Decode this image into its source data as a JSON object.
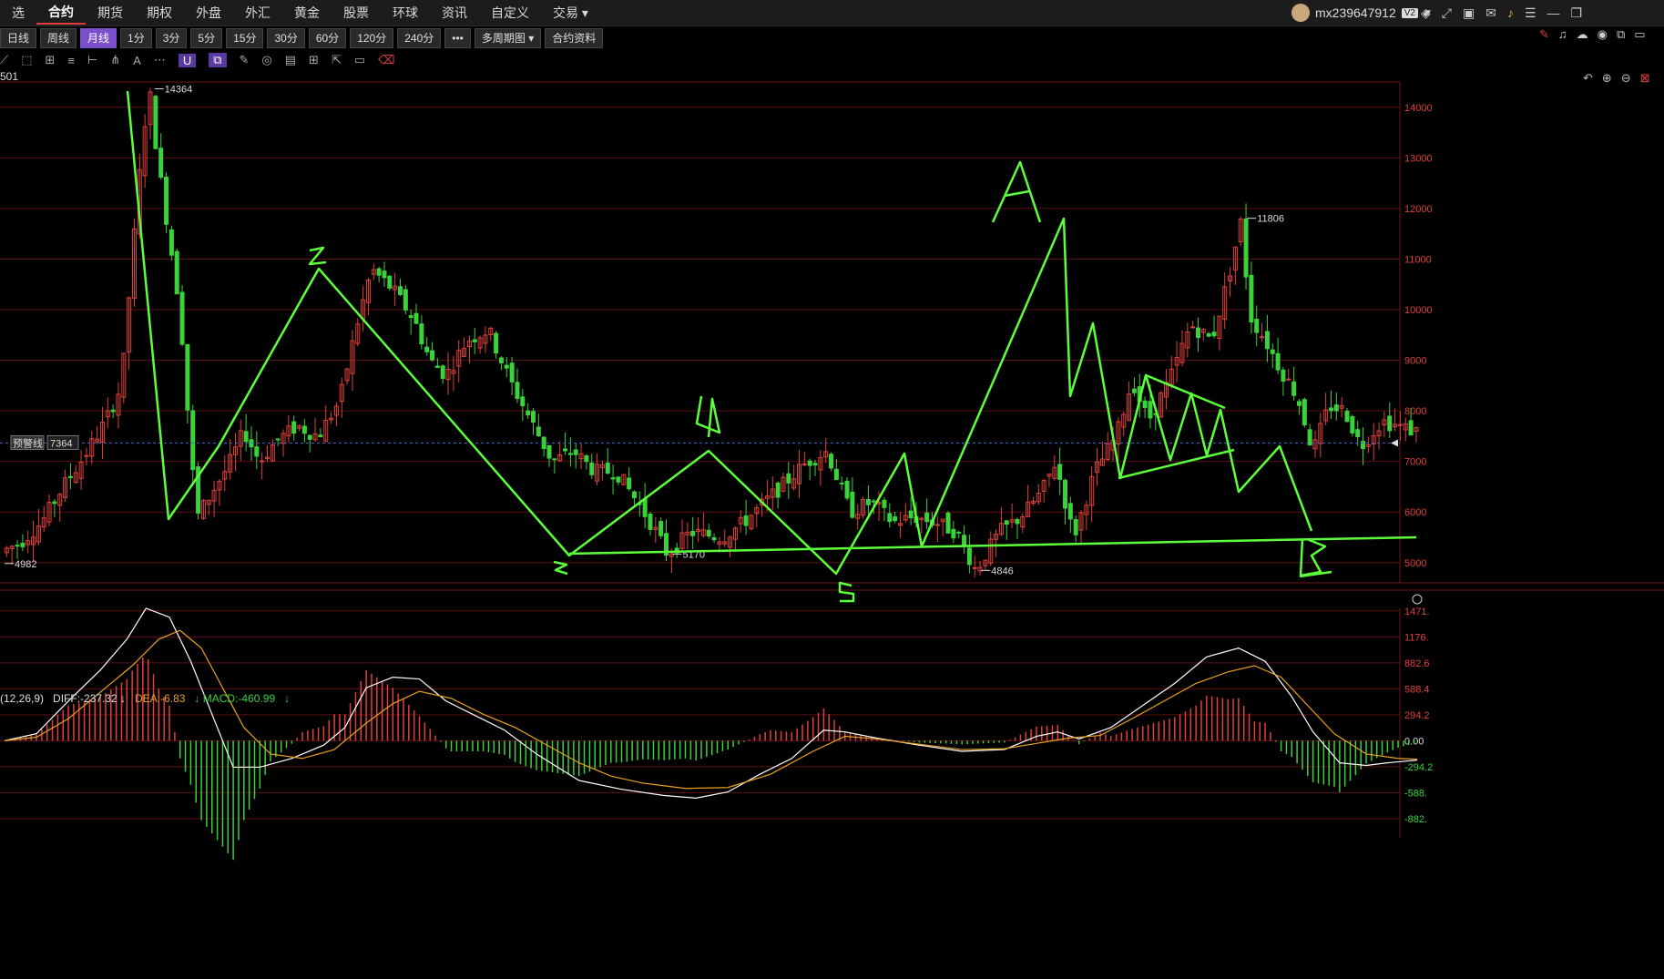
{
  "nav": {
    "items": [
      "选",
      "合约",
      "期货",
      "期权",
      "外盘",
      "外汇",
      "黄金",
      "股票",
      "环球",
      "资讯",
      "自定义",
      "交易 ▾"
    ],
    "active_index": 1
  },
  "user": {
    "name": "mx239647912",
    "badge": "V2"
  },
  "periods": {
    "items": [
      "日线",
      "周线",
      "月线",
      "1分",
      "3分",
      "5分",
      "15分",
      "30分",
      "60分",
      "120分",
      "240分",
      "•••",
      "多周期图 ▾",
      "合约资料"
    ],
    "active_index": 2
  },
  "code_label": "501",
  "alert": {
    "label": "预警线",
    "value": "7364"
  },
  "macd_label": {
    "params": "(12,26,9)",
    "diff": "DIFF:-237.32 ↓",
    "dea": "DEA:-6.83",
    "macd": "↓ MACD:-460.99",
    "arrow": "↓"
  },
  "colors": {
    "up": "#e0403a",
    "down": "#3ad13a",
    "drawing": "#5bff3a",
    "diff_line": "#ffffff",
    "dea_line": "#e8a020",
    "grid": "#5a1010"
  },
  "chart_data": [
    {
      "type": "candlestick",
      "title": "",
      "ylim": [
        4600,
        14500
      ],
      "y_ticks": [
        14000,
        13000,
        12000,
        11000,
        10000,
        9000,
        8000,
        7000,
        6000,
        5000
      ],
      "y_tick_labels": [
        "14000",
        "13000",
        "12000",
        "11000",
        "10000",
        "9000",
        "8000",
        "7000",
        "6000",
        "5000"
      ],
      "annotations": [
        {
          "label": "14364",
          "value": 14364
        },
        {
          "label": "11806",
          "value": 11806
        },
        {
          "label": "5170",
          "value": 5170
        },
        {
          "label": "4846",
          "value": 4846
        },
        {
          "label": "4982",
          "value": 4982
        }
      ],
      "current_price": 7364,
      "price_path": [
        [
          0,
          5200
        ],
        [
          20,
          5400
        ],
        [
          40,
          5800
        ],
        [
          60,
          6500
        ],
        [
          80,
          7100
        ],
        [
          100,
          7800
        ],
        [
          115,
          8500
        ],
        [
          125,
          11000
        ],
        [
          135,
          13400
        ],
        [
          141,
          14364
        ],
        [
          150,
          12800
        ],
        [
          160,
          11400
        ],
        [
          170,
          10000
        ],
        [
          180,
          7200
        ],
        [
          186,
          5900
        ],
        [
          200,
          6400
        ],
        [
          215,
          6900
        ],
        [
          230,
          7600
        ],
        [
          245,
          7000
        ],
        [
          260,
          7400
        ],
        [
          280,
          7700
        ],
        [
          300,
          7500
        ],
        [
          320,
          8200
        ],
        [
          335,
          9600
        ],
        [
          350,
          10800
        ],
        [
          370,
          10400
        ],
        [
          390,
          9800
        ],
        [
          405,
          9000
        ],
        [
          420,
          8700
        ],
        [
          440,
          9400
        ],
        [
          460,
          9600
        ],
        [
          480,
          8600
        ],
        [
          500,
          7800
        ],
        [
          520,
          7000
        ],
        [
          540,
          7200
        ],
        [
          560,
          6800
        ],
        [
          580,
          6800
        ],
        [
          600,
          6200
        ],
        [
          615,
          5700
        ],
        [
          628,
          5170
        ],
        [
          650,
          5600
        ],
        [
          680,
          5500
        ],
        [
          700,
          5800
        ],
        [
          720,
          6200
        ],
        [
          740,
          6600
        ],
        [
          760,
          7000
        ],
        [
          778,
          7200
        ],
        [
          800,
          6000
        ],
        [
          820,
          6200
        ],
        [
          840,
          5800
        ],
        [
          860,
          5900
        ],
        [
          880,
          5800
        ],
        [
          900,
          5600
        ],
        [
          918,
          4846
        ],
        [
          940,
          5600
        ],
        [
          960,
          5900
        ],
        [
          980,
          6400
        ],
        [
          993,
          7000
        ],
        [
          1010,
          5500
        ],
        [
          1030,
          6800
        ],
        [
          1050,
          7500
        ],
        [
          1065,
          8600
        ],
        [
          1080,
          7800
        ],
        [
          1100,
          8600
        ],
        [
          1120,
          9700
        ],
        [
          1140,
          9400
        ],
        [
          1155,
          10600
        ],
        [
          1168,
          11806
        ],
        [
          1175,
          9900
        ],
        [
          1190,
          9400
        ],
        [
          1205,
          8800
        ],
        [
          1220,
          8300
        ],
        [
          1235,
          7200
        ],
        [
          1250,
          8100
        ],
        [
          1265,
          8000
        ],
        [
          1280,
          7300
        ],
        [
          1300,
          7800
        ],
        [
          1315,
          7700
        ],
        [
          1330,
          7600
        ]
      ]
    },
    {
      "type": "macd",
      "params": "(12,26,9)",
      "y_ticks": [
        1471,
        1176,
        882.6,
        588.4,
        294.2,
        0,
        -294.2,
        -588.4,
        -882.6
      ],
      "y_tick_labels": [
        "1471.",
        "1176.",
        "882.6",
        "588.4",
        "294.2",
        "0.00",
        "-294.2",
        "-588.",
        "-882."
      ],
      "ylim": [
        -1100,
        1500
      ],
      "diff_path": [
        [
          0,
          0
        ],
        [
          30,
          80
        ],
        [
          60,
          450
        ],
        [
          90,
          800
        ],
        [
          115,
          1150
        ],
        [
          133,
          1500
        ],
        [
          155,
          1400
        ],
        [
          175,
          900
        ],
        [
          195,
          300
        ],
        [
          215,
          -300
        ],
        [
          240,
          -300
        ],
        [
          270,
          -200
        ],
        [
          300,
          -50
        ],
        [
          320,
          150
        ],
        [
          340,
          600
        ],
        [
          365,
          720
        ],
        [
          390,
          700
        ],
        [
          415,
          450
        ],
        [
          440,
          300
        ],
        [
          470,
          120
        ],
        [
          500,
          -150
        ],
        [
          540,
          -450
        ],
        [
          580,
          -550
        ],
        [
          620,
          -620
        ],
        [
          650,
          -650
        ],
        [
          680,
          -580
        ],
        [
          710,
          -380
        ],
        [
          740,
          -200
        ],
        [
          770,
          120
        ],
        [
          790,
          100
        ],
        [
          820,
          30
        ],
        [
          860,
          -50
        ],
        [
          900,
          -120
        ],
        [
          940,
          -100
        ],
        [
          970,
          50
        ],
        [
          990,
          100
        ],
        [
          1010,
          20
        ],
        [
          1040,
          150
        ],
        [
          1070,
          400
        ],
        [
          1100,
          650
        ],
        [
          1130,
          950
        ],
        [
          1160,
          1050
        ],
        [
          1185,
          900
        ],
        [
          1210,
          500
        ],
        [
          1230,
          100
        ],
        [
          1255,
          -250
        ],
        [
          1280,
          -280
        ],
        [
          1300,
          -250
        ],
        [
          1328,
          -220
        ]
      ],
      "dea_path": [
        [
          0,
          0
        ],
        [
          30,
          40
        ],
        [
          60,
          250
        ],
        [
          90,
          550
        ],
        [
          120,
          850
        ],
        [
          145,
          1150
        ],
        [
          165,
          1250
        ],
        [
          185,
          1050
        ],
        [
          205,
          600
        ],
        [
          225,
          150
        ],
        [
          250,
          -150
        ],
        [
          280,
          -200
        ],
        [
          310,
          -100
        ],
        [
          340,
          200
        ],
        [
          365,
          420
        ],
        [
          390,
          560
        ],
        [
          420,
          480
        ],
        [
          450,
          300
        ],
        [
          480,
          150
        ],
        [
          510,
          -50
        ],
        [
          540,
          -250
        ],
        [
          570,
          -400
        ],
        [
          600,
          -480
        ],
        [
          640,
          -540
        ],
        [
          680,
          -530
        ],
        [
          720,
          -380
        ],
        [
          760,
          -120
        ],
        [
          790,
          50
        ],
        [
          820,
          20
        ],
        [
          860,
          -40
        ],
        [
          900,
          -100
        ],
        [
          940,
          -90
        ],
        [
          970,
          -30
        ],
        [
          1000,
          30
        ],
        [
          1030,
          60
        ],
        [
          1060,
          250
        ],
        [
          1090,
          450
        ],
        [
          1120,
          650
        ],
        [
          1150,
          780
        ],
        [
          1175,
          850
        ],
        [
          1200,
          720
        ],
        [
          1225,
          400
        ],
        [
          1250,
          80
        ],
        [
          1280,
          -150
        ],
        [
          1310,
          -200
        ],
        [
          1328,
          -210
        ]
      ]
    }
  ],
  "drawings": {
    "labels": [
      "A",
      "B",
      "Z",
      "3",
      "4",
      "5"
    ]
  }
}
